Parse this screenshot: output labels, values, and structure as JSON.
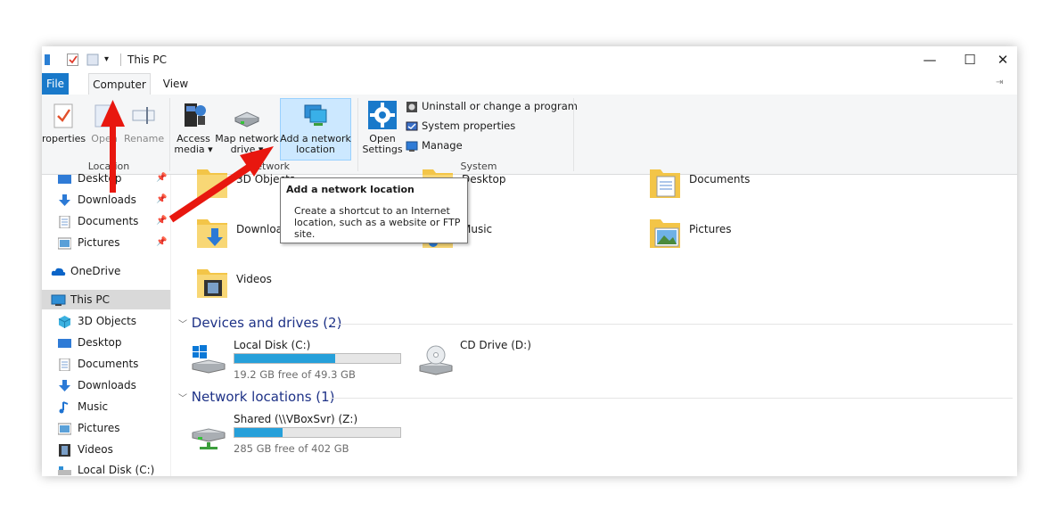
{
  "window": {
    "title": "This PC",
    "controls": {
      "minimize": "—",
      "maximize": "☐",
      "close": "✕"
    }
  },
  "tabs": [
    {
      "label": "File"
    },
    {
      "label": "Computer"
    },
    {
      "label": "View"
    }
  ],
  "ribbon": {
    "location": {
      "group_label": "Location",
      "properties": "roperties",
      "open": "Open",
      "rename": "Rename"
    },
    "network": {
      "group_label": "Network",
      "access_media_1": "Access",
      "access_media_2": "media ▾",
      "map_drive_1": "Map network",
      "map_drive_2": "drive ▾",
      "add_location_1": "Add a network",
      "add_location_2": "location"
    },
    "system": {
      "group_label": "System",
      "open_settings_1": "Open",
      "open_settings_2": "Settings",
      "uninstall": "Uninstall or change a program",
      "system_properties": "System properties",
      "manage": "Manage"
    }
  },
  "tooltip": {
    "title": "Add a network location",
    "description": "Create a shortcut to an Internet location, such as a website or FTP site."
  },
  "nav": {
    "quick_access": [
      {
        "label": "Desktop"
      },
      {
        "label": "Downloads"
      },
      {
        "label": "Documents"
      },
      {
        "label": "Pictures"
      }
    ],
    "onedrive": "OneDrive",
    "this_pc": "This PC",
    "this_pc_items": [
      {
        "label": "3D Objects"
      },
      {
        "label": "Desktop"
      },
      {
        "label": "Documents"
      },
      {
        "label": "Downloads"
      },
      {
        "label": "Music"
      },
      {
        "label": "Pictures"
      },
      {
        "label": "Videos"
      },
      {
        "label": "Local Disk (C:)"
      }
    ]
  },
  "folders": [
    {
      "label": "3D Objects"
    },
    {
      "label": "Desktop"
    },
    {
      "label": "Documents"
    },
    {
      "label": "Downloads"
    },
    {
      "label": "Music"
    },
    {
      "label": "Pictures"
    },
    {
      "label": "Videos"
    }
  ],
  "devices": {
    "header": "Devices and drives (2)",
    "drives": [
      {
        "name": "Local Disk (C:)",
        "free": "19.2 GB free of 49.3 GB",
        "used_fraction": 0.61
      },
      {
        "name": "CD Drive (D:)"
      }
    ]
  },
  "network_locations": {
    "header": "Network locations (1)",
    "items": [
      {
        "name": "Shared (\\\\VBoxSvr) (Z:)",
        "free": "285 GB free of 402 GB",
        "used_fraction": 0.29
      }
    ]
  },
  "colors": {
    "accent": "#1979ca",
    "selection": "#cce8ff",
    "drive_fill": "#26a0da",
    "annotation_arrow": "#e8170f",
    "section_header": "#1e3287"
  }
}
